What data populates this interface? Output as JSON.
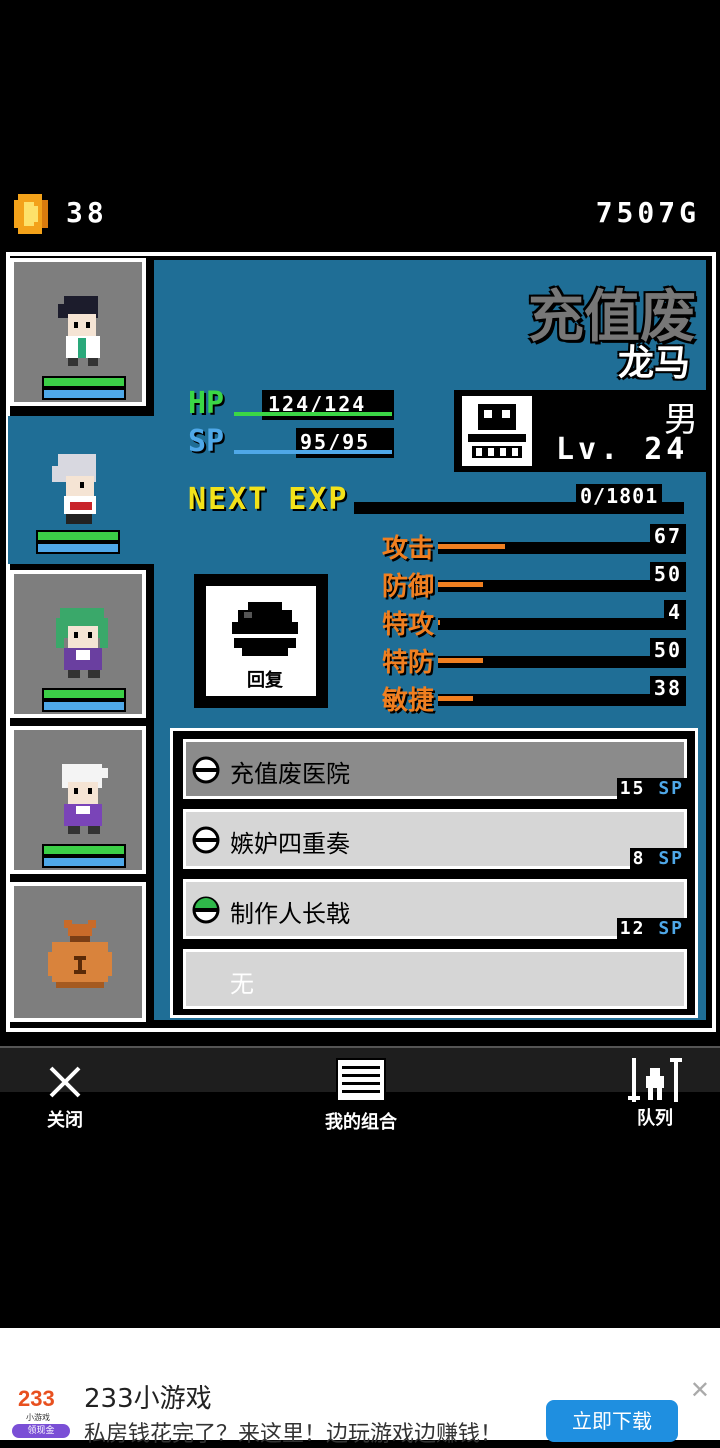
{
  "header": {
    "coin_count": "38",
    "gold": "7507G"
  },
  "character": {
    "name": "充值废",
    "subname": "龙马",
    "gender": "男",
    "level": "Lv. 24",
    "hp_label": "HP",
    "hp_value": "124/124",
    "hp_fraction": 1.0,
    "sp_label": "SP",
    "sp_value": "95/95",
    "sp_fraction": 1.0,
    "next_exp_label": "NEXT EXP",
    "next_exp_value": "0/1801"
  },
  "attributes": [
    {
      "label": "攻击",
      "value": "67",
      "fraction": 0.27
    },
    {
      "label": "防御",
      "value": "50",
      "fraction": 0.18
    },
    {
      "label": "特攻",
      "value": "4",
      "fraction": 0.01
    },
    {
      "label": "特防",
      "value": "50",
      "fraction": 0.18
    },
    {
      "label": "敏捷",
      "value": "38",
      "fraction": 0.14
    }
  ],
  "recover": {
    "label": "回复"
  },
  "skills": [
    {
      "name": "充值废医院",
      "cost": "15",
      "unit": "SP",
      "icon": "white-ball-icon"
    },
    {
      "name": "嫉妒四重奏",
      "cost": "8",
      "unit": "SP",
      "icon": "white-ball-icon"
    },
    {
      "name": "制作人长戟",
      "cost": "12",
      "unit": "SP",
      "icon": "green-ball-icon"
    },
    {
      "name": "无"
    }
  ],
  "nav": {
    "close": "关闭",
    "combo": "我的组合",
    "team": "队列"
  },
  "ad": {
    "logo_text": "233",
    "logo_sub": "小游戏",
    "logo_badge": "领现金",
    "title": "233小游戏",
    "desc": "私房钱花完了？来这里！边玩游戏边赚钱！",
    "button": "立即下载"
  },
  "colors": {
    "panel_blue": "#1f6e96",
    "hp_green": "#3bd645",
    "sp_blue": "#4fa8e8",
    "exp_yellow": "#f2e21a",
    "attr_orange": "#f07f20"
  }
}
